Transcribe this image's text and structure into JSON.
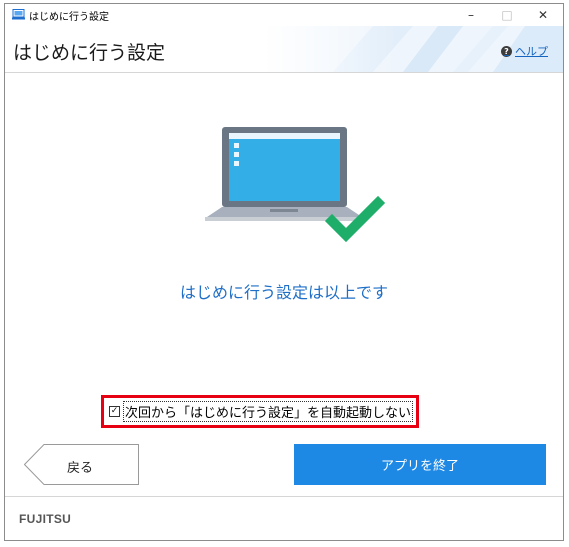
{
  "window": {
    "title": "はじめに行う設定",
    "controls": {
      "minimize": "–",
      "maximize": "□",
      "close": "✕"
    }
  },
  "header": {
    "title": "はじめに行う設定",
    "help_label": "ヘルプ",
    "help_icon": "?"
  },
  "main": {
    "illustration": "laptop-with-checkmark",
    "message": "はじめに行う設定は以上です"
  },
  "autostart": {
    "checked": true,
    "check_glyph": "✓",
    "label": "次回から「はじめに行う設定」を自動起動しない"
  },
  "buttons": {
    "back": "戻る",
    "finish": "アプリを終了"
  },
  "footer": {
    "logo": "FUJITSU"
  },
  "colors": {
    "accent_blue": "#1e88e5",
    "message_blue": "#1f6fc7",
    "check_green": "#1fae6a",
    "highlight_red": "#e60012"
  }
}
